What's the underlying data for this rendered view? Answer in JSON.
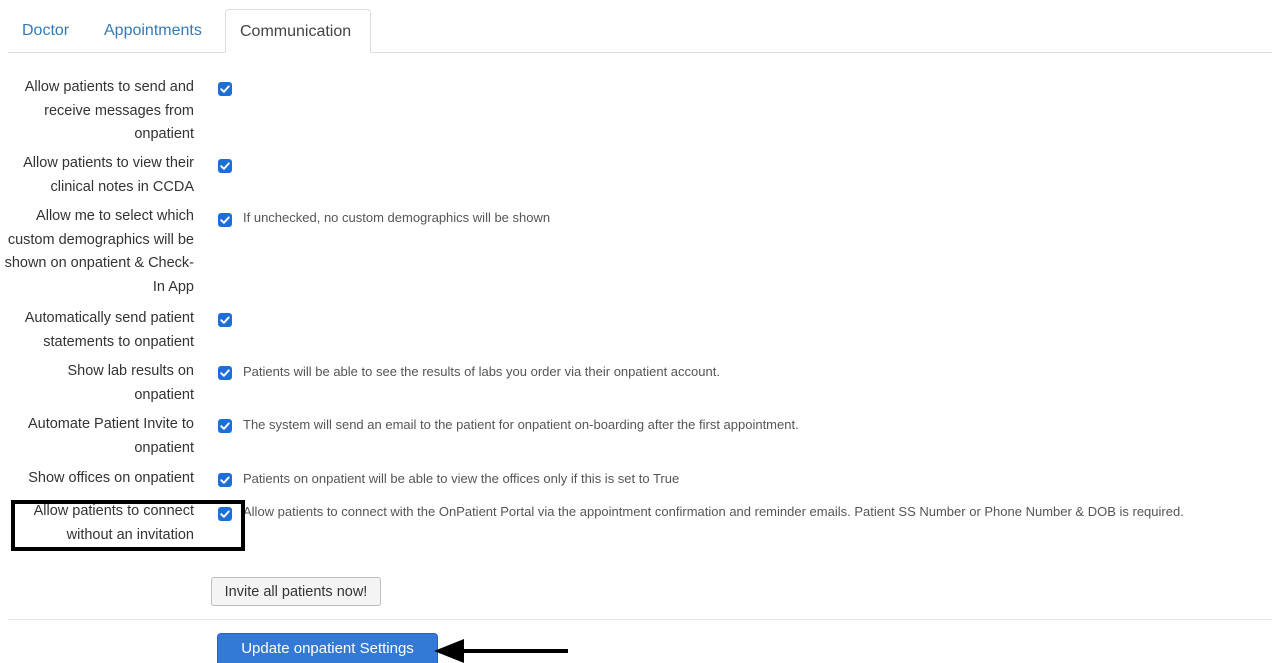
{
  "tabs": [
    {
      "label": "Doctor",
      "active": false
    },
    {
      "label": "Appointments",
      "active": false
    },
    {
      "label": "Communication",
      "active": true
    }
  ],
  "settings": [
    {
      "label": "Allow patients to send and receive messages from onpatient",
      "checked": true,
      "help": ""
    },
    {
      "label": "Allow patients to view their clinical notes in CCDA",
      "checked": true,
      "help": ""
    },
    {
      "label": "Allow me to select which custom demographics will be shown on onpatient & Check-In App",
      "checked": true,
      "help": "If unchecked, no custom demographics will be shown"
    },
    {
      "label": "Automatically send patient statements to onpatient",
      "checked": true,
      "help": ""
    },
    {
      "label": "Show lab results on onpatient",
      "checked": true,
      "help": "Patients will be able to see the results of labs you order via their onpatient account."
    },
    {
      "label": "Automate Patient Invite to onpatient",
      "checked": true,
      "help": "The system will send an email to the patient for onpatient on-boarding after the first appointment."
    },
    {
      "label": "Show offices on onpatient",
      "checked": true,
      "help": "Patients on onpatient will be able to view the offices only if this is set to True"
    },
    {
      "label": "Allow patients to connect without an invitation",
      "checked": true,
      "help": "Allow patients to connect with the OnPatient Portal via the appointment confirmation and reminder emails. Patient SS Number or Phone Number & DOB is required."
    }
  ],
  "buttons": {
    "invite": "Invite all patients now!",
    "update": "Update onpatient Settings"
  },
  "colors": {
    "link": "#337ab7",
    "checkbox": "#1d6fd8",
    "primary_button": "#3579d6",
    "annotation": "#000000"
  }
}
